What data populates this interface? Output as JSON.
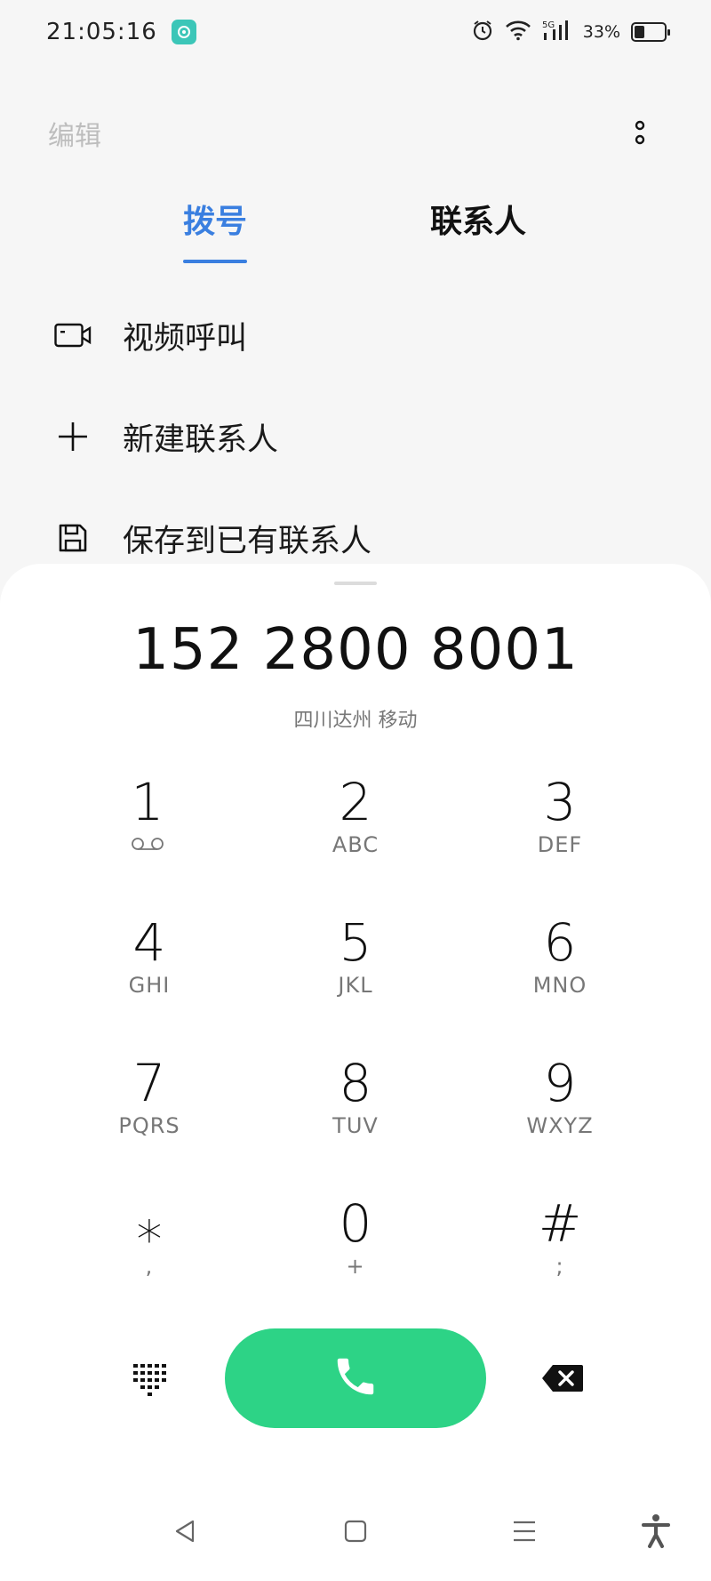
{
  "status_bar": {
    "time": "21:05:16",
    "battery_percent": "33%",
    "battery_level": 0.33,
    "icons": [
      "app-badge-icon",
      "alarm-icon",
      "wifi-icon",
      "5g-signal-icon",
      "battery-icon"
    ]
  },
  "header": {
    "edit_label": "编辑",
    "more_icon": "more-vertical-icon"
  },
  "tabs": [
    {
      "label": "拨号",
      "active": true
    },
    {
      "label": "联系人",
      "active": false
    }
  ],
  "actions": [
    {
      "label": "视频呼叫",
      "icon": "video-call-icon"
    },
    {
      "label": "新建联系人",
      "icon": "plus-icon"
    },
    {
      "label": "保存到已有联系人",
      "icon": "save-icon"
    }
  ],
  "dialer": {
    "number": "152 2800 8001",
    "location": "四川达州 移动",
    "keys": [
      {
        "digit": "1",
        "sub": "voicemail-icon"
      },
      {
        "digit": "2",
        "sub": "ABC"
      },
      {
        "digit": "3",
        "sub": "DEF"
      },
      {
        "digit": "4",
        "sub": "GHI"
      },
      {
        "digit": "5",
        "sub": "JKL"
      },
      {
        "digit": "6",
        "sub": "MNO"
      },
      {
        "digit": "7",
        "sub": "PQRS"
      },
      {
        "digit": "8",
        "sub": "TUV"
      },
      {
        "digit": "9",
        "sub": "WXYZ"
      },
      {
        "digit": "⁎",
        "sub": ","
      },
      {
        "digit": "0",
        "sub": "+"
      },
      {
        "digit": "#",
        "sub": ";"
      }
    ],
    "call_icon": "phone-icon",
    "keypad_icon": "keypad-grid-icon",
    "backspace_icon": "backspace-icon",
    "call_color": "#2dd386",
    "accent_color": "#3a7fe0"
  },
  "navigation": {
    "icons": [
      "back-icon",
      "home-icon",
      "menu-icon",
      "accessibility-icon"
    ]
  }
}
